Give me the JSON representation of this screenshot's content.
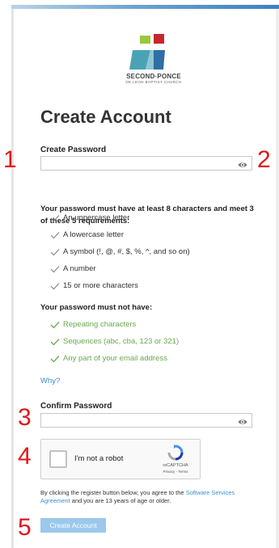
{
  "logo": {
    "name": "SECOND·PONCE",
    "subtitle": "DE LEON BAPTIST CHURCH",
    "colors": {
      "green": "#9ac83c",
      "red": "#c8262e",
      "teal": "#4aa3b5",
      "blue": "#2f6fa5"
    }
  },
  "page": {
    "title": "Create Account"
  },
  "password": {
    "label": "Create Password",
    "value": "",
    "placeholder": "",
    "toggle_icon": "eye-icon"
  },
  "requirements": {
    "intro": "Your password must have at least 8 characters and meet 3 of these 5 requirements:",
    "items": [
      "An uppercase letter",
      "A lowercase letter",
      "A symbol (!, @, #, $, %, ^, and so on)",
      "A number",
      "15 or more characters"
    ]
  },
  "must_not": {
    "heading": "Your password must not have:",
    "items": [
      "Repeating characters",
      "Sequences (abc, cba, 123 or 321)",
      "Any part of your email address"
    ]
  },
  "why_link": "Why?",
  "confirm": {
    "label": "Confirm Password",
    "value": "",
    "placeholder": "",
    "toggle_icon": "eye-icon"
  },
  "captcha": {
    "label": "I'm not a robot",
    "brand": "reCAPTCHA",
    "links": "Privacy - Terms",
    "checked": false
  },
  "terms": {
    "prefix": "By clicking the register button below, you agree to the ",
    "link": "Software Services Agreement",
    "suffix": " and you are 13 years of age or older."
  },
  "submit_label": "Create Account",
  "annotations": [
    "1",
    "2",
    "3",
    "4",
    "5"
  ],
  "colors": {
    "accent": "#3a8fd1",
    "valid": "#6aa84f",
    "annotation": "#e0161b",
    "button_disabled": "#9cc8ec"
  }
}
